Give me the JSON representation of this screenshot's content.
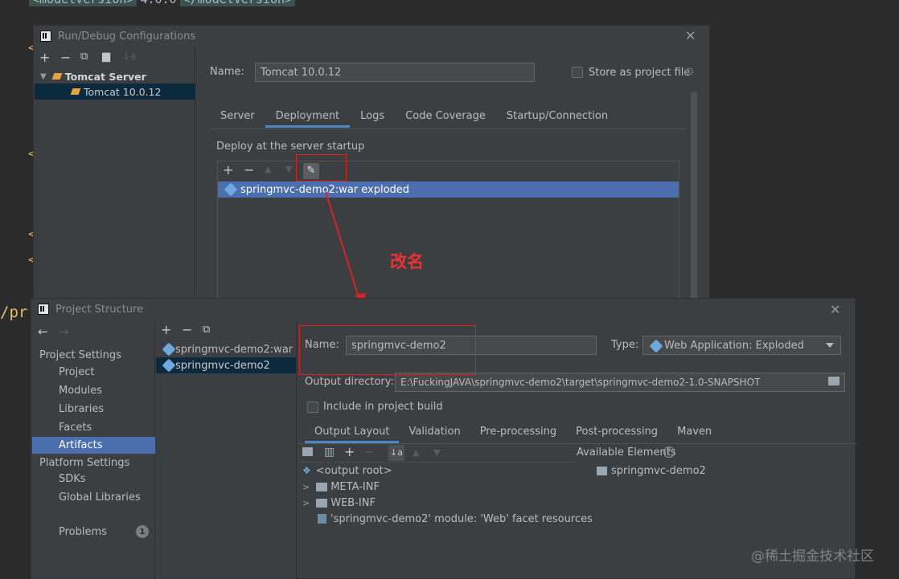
{
  "editor": {
    "top_snippet_a": "<modelVersion>",
    "top_snippet_b": "4.0.0",
    "top_snippet_c": "</modelVersion>",
    "gutter_marks": [
      "<",
      "<",
      "<",
      "<",
      "<"
    ],
    "line_fragment": "/pr"
  },
  "run_debug": {
    "title": "Run/Debug Configurations",
    "toolbar": [
      "+",
      "−",
      "copy",
      "folder",
      "sort"
    ],
    "tree_group": "Tomcat Server",
    "tree_item": "Tomcat 10.0.12",
    "name_label": "Name:",
    "name_value": "Tomcat 10.0.12",
    "store_label": "Store as project file",
    "tabs": [
      "Server",
      "Deployment",
      "Logs",
      "Code Coverage",
      "Startup/Connection"
    ],
    "active_tab": "Deployment",
    "deploy_heading": "Deploy at the server startup",
    "deploy_item": "springmvc-demo2:war exploded"
  },
  "annotation": {
    "text": "改名",
    "color": "#e02020"
  },
  "project_structure": {
    "title": "Project Structure",
    "nav": {
      "project_settings_heading": "Project Settings",
      "project_settings": [
        "Project",
        "Modules",
        "Libraries",
        "Facets",
        "Artifacts"
      ],
      "platform_settings_heading": "Platform Settings",
      "platform_settings": [
        "SDKs",
        "Global Libraries"
      ],
      "problems_label": "Problems",
      "problems_count": "1"
    },
    "artifacts": [
      "springmvc-demo2:war",
      "springmvc-demo2"
    ],
    "name_label": "Name:",
    "name_value": "springmvc-demo2",
    "type_label": "Type:",
    "type_value": "Web Application: Exploded",
    "output_label": "Output directory:",
    "output_value": "E:\\FuckingJAVA\\springmvc-demo2\\target\\springmvc-demo2-1.0-SNAPSHOT",
    "include_label": "Include in project build",
    "tabs": [
      "Output Layout",
      "Validation",
      "Pre-processing",
      "Post-processing",
      "Maven"
    ],
    "active_tab": "Output Layout",
    "available_label": "Available Elements",
    "layout_tree": [
      "<output root>",
      "META-INF",
      "WEB-INF",
      "'springmvc-demo2' module: 'Web' facet resources"
    ],
    "available_tree": [
      "springmvc-demo2"
    ]
  },
  "watermark": "@稀土掘金技术社区",
  "colors": {
    "selection": "#4b6eaf",
    "tab_underline": "#4a88c7",
    "dialog_bg": "#3c3f41",
    "editor_bg": "#2b2b2b"
  }
}
